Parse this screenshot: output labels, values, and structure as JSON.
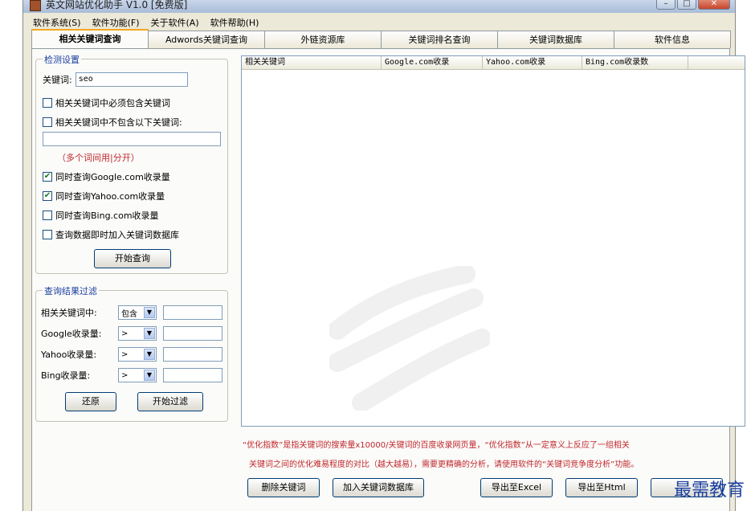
{
  "window": {
    "title": "英文网站优化助手 V1.0 [免费版]",
    "btn_min": "–",
    "btn_max": "□",
    "btn_close": "✕"
  },
  "menu": [
    "软件系统(S)",
    "软件功能(F)",
    "关于软件(A)",
    "软件帮助(H)"
  ],
  "tabs": [
    {
      "label": "相关关键词查询",
      "active": true
    },
    {
      "label": "Adwords关键词查询",
      "active": false
    },
    {
      "label": "外链资源库",
      "active": false
    },
    {
      "label": "关键词排名查询",
      "active": false
    },
    {
      "label": "关键词数据库",
      "active": false
    },
    {
      "label": "软件信息",
      "active": false
    }
  ],
  "detect": {
    "legend": "检测设置",
    "keyword_label": "关键词:",
    "keyword_value": "seo",
    "must_contain": {
      "label": "相关关键词中必须包含关键词",
      "checked": false
    },
    "exclude": {
      "label": "相关关键词中不包含以下关键词:",
      "checked": false
    },
    "exclude_value": "",
    "hint": "（多个词间用|分开）",
    "google": {
      "label": "同时查询Google.com收录量",
      "checked": true
    },
    "yahoo": {
      "label": "同时查询Yahoo.com收录量",
      "checked": true
    },
    "bing": {
      "label": "同时查询Bing.com收录量",
      "checked": false
    },
    "add_db": {
      "label": "查询数据即时加入关键词数据库",
      "checked": false
    },
    "start_button": "开始查询"
  },
  "filter": {
    "legend": "查询结果过滤",
    "rows": [
      {
        "label": "相关关键词中:",
        "op": "包含",
        "value": ""
      },
      {
        "label": "Google收录量:",
        "op": ">",
        "value": ""
      },
      {
        "label": "Yahoo收录量:",
        "op": ">",
        "value": ""
      },
      {
        "label": "Bing收录量:",
        "op": ">",
        "value": ""
      }
    ],
    "reset_button": "还原",
    "start_filter_button": "开始过滤"
  },
  "results": {
    "columns": [
      "相关关键词",
      "Google.com收录",
      "Yahoo.com收录",
      "Bing.com收录数"
    ]
  },
  "note_line1": "“优化指数”是指关键词的搜索量x10000/关键词的百度收录网页量，“优化指数”从一定意义上反应了一组相关",
  "note_line2": "关键词之间的优化难易程度的对比（越大越易），需要更精确的分析，请使用软件的“关键词竞争度分析”功能。",
  "actions": {
    "delete": "删除关键词",
    "add_db": "加入关键词数据库",
    "export_excel": "导出至Excel",
    "export_html": "导出至Html"
  },
  "watermark": "最需教育"
}
